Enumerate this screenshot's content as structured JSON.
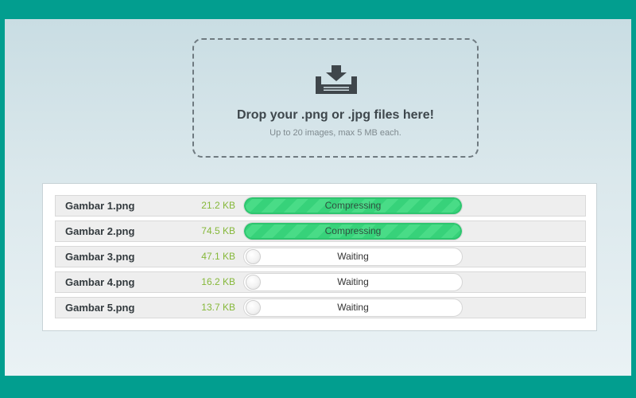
{
  "dropzone": {
    "icon": "download-tray-icon",
    "title": "Drop your .png or .jpg files here!",
    "subtitle": "Up to 20 images, max 5 MB each."
  },
  "colors": {
    "frame": "#029e8f",
    "progress": "#37d27a",
    "size_text": "#86b83a"
  },
  "files": [
    {
      "name": "Gambar 1.png",
      "size": "21.2 KB",
      "status": "Compressing",
      "progress": 1.0
    },
    {
      "name": "Gambar 2.png",
      "size": "74.5 KB",
      "status": "Compressing",
      "progress": 1.0
    },
    {
      "name": "Gambar 3.png",
      "size": "47.1 KB",
      "status": "Waiting",
      "progress": 0
    },
    {
      "name": "Gambar 4.png",
      "size": "16.2 KB",
      "status": "Waiting",
      "progress": 0
    },
    {
      "name": "Gambar 5.png",
      "size": "13.7 KB",
      "status": "Waiting",
      "progress": 0
    }
  ]
}
